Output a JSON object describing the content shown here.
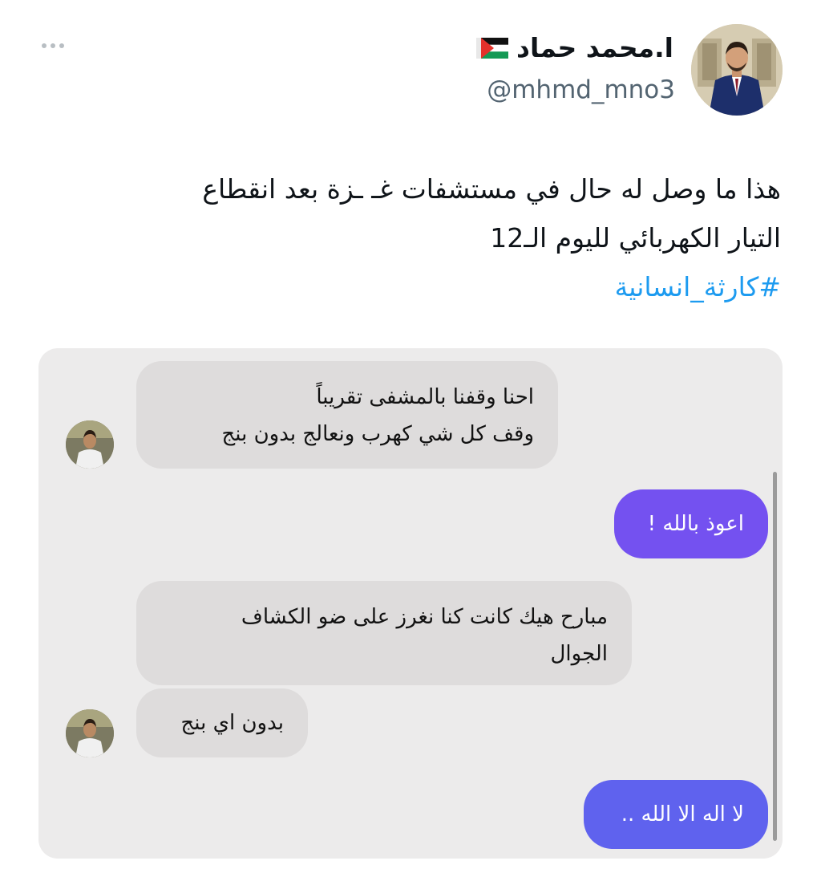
{
  "tweet": {
    "more_icon": "more-horizontal-icon",
    "author_name": "ا.محمد حماد",
    "author_emoji": "🇵🇸",
    "handle": "@mhmd_mno3",
    "text_line1": "هذا ما وصل له حال في مستشفات غـ ـزة بعد انقطاع",
    "text_line2": "التيار الكهربائي لليوم الـ12",
    "hashtag": "#كارثة_انسانية"
  },
  "chat": {
    "messages": [
      {
        "side": "received",
        "line1": "احنا وقفنا بالمشفى تقريباً",
        "line2": "وقف كل شي كهرب ونعالج بدون بنج"
      },
      {
        "side": "sent",
        "text": "اعوذ بالله !"
      },
      {
        "side": "received",
        "line1": "مبارح هيك كانت كنا نغرز على ضو الكشاف",
        "line2": "الجوال"
      },
      {
        "side": "received",
        "text": "بدون اي بنج"
      },
      {
        "side": "sent",
        "text": "لا اله الا الله .."
      }
    ]
  },
  "colors": {
    "hashtag": "#1d9bf0",
    "sent_bubble_1": "#7451f0",
    "sent_bubble_2": "#5f62ee",
    "chat_bg": "#ecebeb",
    "received_bubble": "#dedcdc",
    "handle": "#536471"
  }
}
